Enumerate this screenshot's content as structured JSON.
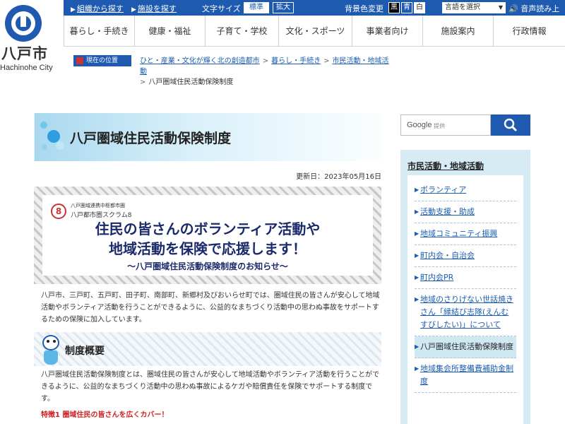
{
  "logo": {
    "name_jp": "八戸市",
    "name_en": "Hachinohe City"
  },
  "topbar": {
    "org_link": "組織から探す",
    "facility_link": "施設を探す",
    "font_size_label": "文字サイズ",
    "font_standard": "標準",
    "font_large": "拡大",
    "bg_color_label": "背景色変更",
    "bg_black": "黒",
    "bg_blue": "青",
    "bg_white": "白",
    "language": "言語を選択",
    "voice": "音声読み上げ"
  },
  "nav": [
    "暮らし・手続き",
    "健康・福祉",
    "子育て・学校",
    "文化・スポーツ",
    "事業者向け",
    "施設案内",
    "行政情報"
  ],
  "breadcrumb": {
    "badge": "現在の位置",
    "items": [
      "ひと・産業・文化が輝く北の創造都市",
      "暮らし・手続き",
      "市民活動・地域活動"
    ],
    "current": "八戸圏域住民活動保険制度"
  },
  "main": {
    "title": "八戸圏域住民活動保険制度",
    "updated": "更新日：2023年05月16日",
    "banner": {
      "org_small": "八戸圏域連携中枢都市圏",
      "org_name": "八戸都市圏スクラム8",
      "heading_line1": "住民の皆さんのボランティア活動や",
      "heading_line2": "地域活動を保険で応援します！",
      "subheading": "～八戸圏域住民活動保険制度のお知らせ～"
    },
    "intro": "八戸市、三戸町、五戸町、田子町、南部町、新郷村及びおいらせ町では、圏域住民の皆さんが安心して地域活動やボランティア活動を行うことができるように、公益的なまちづくり活動中の思わぬ事故をサポートするための保険に加入しています。",
    "section_title": "制度概要",
    "description": "八戸圏域住民活動保険制度とは、圏域住民の皆さんが安心して地域活動やボランティア活動を行うことができるように、公益的なまちづくり活動中の思わぬ事故によるケガや賠償責任を保険でサポートする制度です。",
    "feature1": "特徴1 圏域住民の皆さんを広くカバー！"
  },
  "sidebar": {
    "search_brand": "Google",
    "search_placeholder": "提供",
    "heading": "市民活動・地域活動",
    "items": [
      "ボランティア",
      "活動支援・助成",
      "地域コミュニティ振興",
      "町内会・自治会",
      "町内会PR",
      "地域のさりげない世話焼きさん「縁結び志隊(えんむすびしたい)」について",
      "八戸圏域住民活動保険制度",
      "地域集会所整備費補助金制度"
    ]
  },
  "colors": {
    "brand_blue": "#1e5bb0",
    "link_blue": "#1a5db3",
    "feature_red": "#d21f1f",
    "sidebar_bg": "#d6ebf3"
  }
}
